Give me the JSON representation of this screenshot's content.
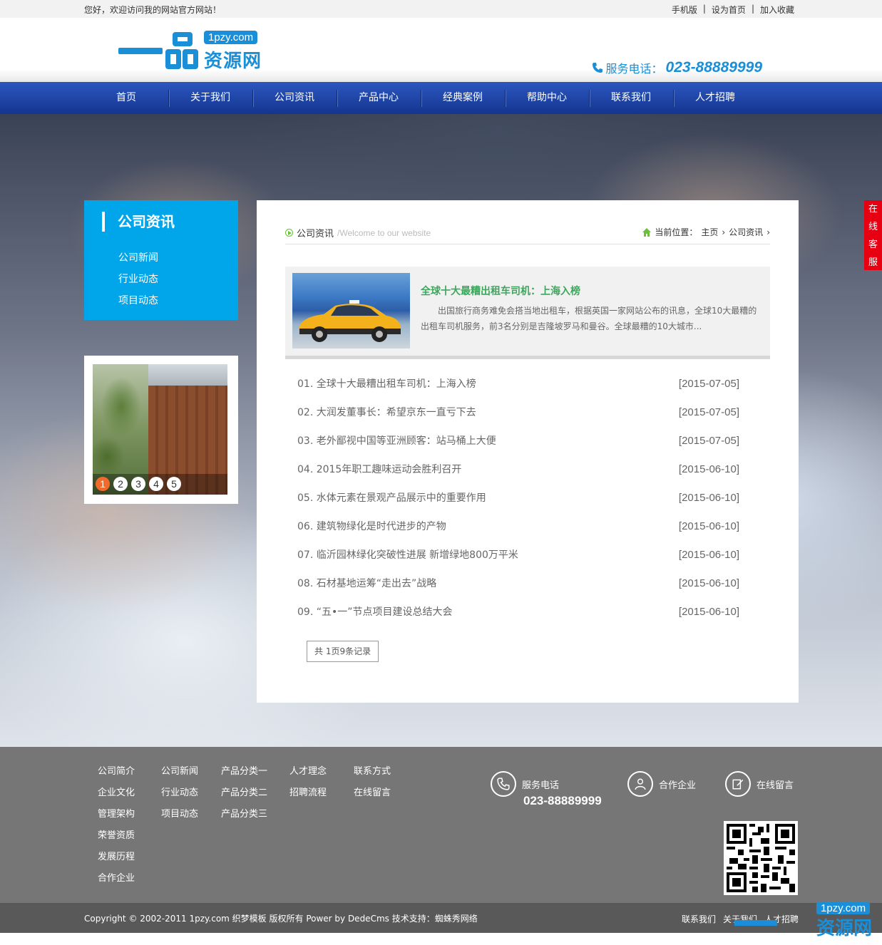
{
  "topbar": {
    "welcome": "您好，欢迎访问我的网站官方网站！",
    "links": [
      "手机版",
      "设为首页",
      "加入收藏"
    ],
    "separator": "|"
  },
  "header": {
    "logo_domain": "1pzy.com",
    "logo_text": "资源网",
    "phone_label": "服务电话：",
    "phone_number": "023-88889999"
  },
  "nav": {
    "items": [
      "首页",
      "关于我们",
      "公司资讯",
      "产品中心",
      "经典案例",
      "帮助中心",
      "联系我们",
      "人才招聘"
    ]
  },
  "sidebar": {
    "title": "公司资讯",
    "items": [
      "公司新闻",
      "行业动态",
      "项目动态"
    ],
    "slider_dots": [
      "1",
      "2",
      "3",
      "4",
      "5"
    ]
  },
  "main": {
    "page_title": "公司资讯",
    "page_subtitle": "/Welcome to our website",
    "location_label": "当前位置：",
    "crumbs": [
      "主页",
      "公司资讯"
    ],
    "featured": {
      "title": "全球十大最糟出租车司机：上海入榜",
      "desc": "出国旅行商务难免会搭当地出租车，根据英国一家网站公布的讯息，全球10大最糟的出租车司机服务，前3名分别是吉隆坡罗马和曼谷。全球最糟的10大城市..."
    },
    "articles": [
      {
        "title": "01. 全球十大最糟出租车司机：上海入榜",
        "date": "[2015-07-05]"
      },
      {
        "title": "02. 大润发董事长：希望京东一直亏下去",
        "date": "[2015-07-05]"
      },
      {
        "title": "03. 老外鄙视中国等亚洲顾客：站马桶上大便",
        "date": "[2015-07-05]"
      },
      {
        "title": "04. 2015年职工趣味运动会胜利召开",
        "date": "[2015-06-10]"
      },
      {
        "title": "05. 水体元素在景观产品展示中的重要作用",
        "date": "[2015-06-10]"
      },
      {
        "title": "06. 建筑物绿化是时代进步的产物",
        "date": "[2015-06-10]"
      },
      {
        "title": "07. 临沂园林绿化突破性进展 新增绿地800万平米",
        "date": "[2015-06-10]"
      },
      {
        "title": "08. 石材基地运筹“走出去”战略",
        "date": "[2015-06-10]"
      },
      {
        "title": "09. “五•一”节点项目建设总结大会",
        "date": "[2015-06-10]"
      }
    ],
    "pager": "共 1页9条记录"
  },
  "service": [
    "在",
    "线",
    "客",
    "服"
  ],
  "footer": {
    "col1": [
      "公司简介",
      "企业文化",
      "管理架构",
      "荣誉资质",
      "发展历程",
      "合作企业"
    ],
    "col2": [
      "公司新闻",
      "行业动态",
      "项目动态"
    ],
    "col3": [
      "产品分类一",
      "产品分类二",
      "产品分类三"
    ],
    "col4": [
      "人才理念",
      "招聘流程"
    ],
    "col5": [
      "联系方式",
      "在线留言"
    ],
    "contact_phone_label": "服务电话",
    "contact_phone": "023-88889999",
    "partners_label": "合作企业",
    "message_label": "在线留言"
  },
  "copyright": {
    "text": "Copyright © 2002-2011 1pzy.com 织梦模板 版权所有 Power by DedeCms 技术支持：蜘蛛秀网络",
    "links": [
      "联系我们",
      "关于我们",
      "人才招聘"
    ]
  },
  "watermark": {
    "domain": "1pzy.com",
    "text": "资源网"
  },
  "colors": {
    "brand_blue": "#1a8fd8",
    "nav_blue": "#1f44a8",
    "sidebar_blue": "#00a6e9",
    "featured_green": "#3ea75d",
    "service_red": "#e60012"
  }
}
